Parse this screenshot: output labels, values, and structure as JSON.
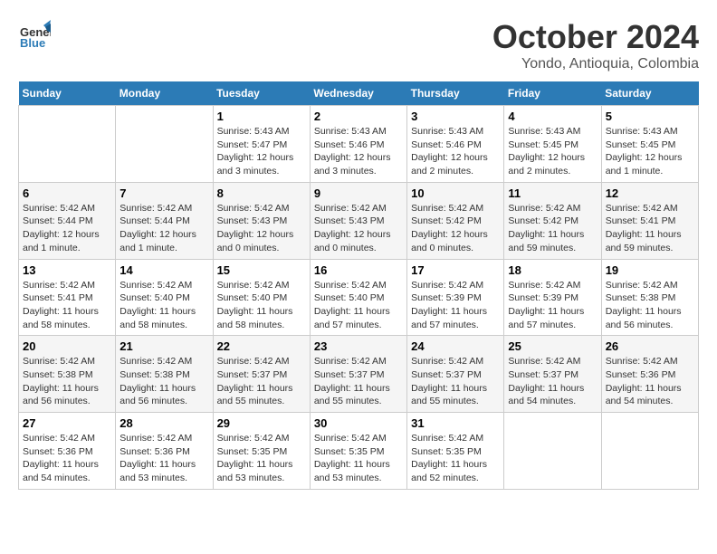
{
  "header": {
    "logo_line1": "General",
    "logo_line2": "Blue",
    "month_title": "October 2024",
    "subtitle": "Yondo, Antioquia, Colombia"
  },
  "weekdays": [
    "Sunday",
    "Monday",
    "Tuesday",
    "Wednesday",
    "Thursday",
    "Friday",
    "Saturday"
  ],
  "weeks": [
    [
      {
        "day": "",
        "empty": true
      },
      {
        "day": "",
        "empty": true
      },
      {
        "day": "1",
        "sunrise": "5:43 AM",
        "sunset": "5:47 PM",
        "daylight": "12 hours and 3 minutes."
      },
      {
        "day": "2",
        "sunrise": "5:43 AM",
        "sunset": "5:46 PM",
        "daylight": "12 hours and 3 minutes."
      },
      {
        "day": "3",
        "sunrise": "5:43 AM",
        "sunset": "5:46 PM",
        "daylight": "12 hours and 2 minutes."
      },
      {
        "day": "4",
        "sunrise": "5:43 AM",
        "sunset": "5:45 PM",
        "daylight": "12 hours and 2 minutes."
      },
      {
        "day": "5",
        "sunrise": "5:43 AM",
        "sunset": "5:45 PM",
        "daylight": "12 hours and 1 minute."
      }
    ],
    [
      {
        "day": "6",
        "sunrise": "5:42 AM",
        "sunset": "5:44 PM",
        "daylight": "12 hours and 1 minute."
      },
      {
        "day": "7",
        "sunrise": "5:42 AM",
        "sunset": "5:44 PM",
        "daylight": "12 hours and 1 minute."
      },
      {
        "day": "8",
        "sunrise": "5:42 AM",
        "sunset": "5:43 PM",
        "daylight": "12 hours and 0 minutes."
      },
      {
        "day": "9",
        "sunrise": "5:42 AM",
        "sunset": "5:43 PM",
        "daylight": "12 hours and 0 minutes."
      },
      {
        "day": "10",
        "sunrise": "5:42 AM",
        "sunset": "5:42 PM",
        "daylight": "12 hours and 0 minutes."
      },
      {
        "day": "11",
        "sunrise": "5:42 AM",
        "sunset": "5:42 PM",
        "daylight": "11 hours and 59 minutes."
      },
      {
        "day": "12",
        "sunrise": "5:42 AM",
        "sunset": "5:41 PM",
        "daylight": "11 hours and 59 minutes."
      }
    ],
    [
      {
        "day": "13",
        "sunrise": "5:42 AM",
        "sunset": "5:41 PM",
        "daylight": "11 hours and 58 minutes."
      },
      {
        "day": "14",
        "sunrise": "5:42 AM",
        "sunset": "5:40 PM",
        "daylight": "11 hours and 58 minutes."
      },
      {
        "day": "15",
        "sunrise": "5:42 AM",
        "sunset": "5:40 PM",
        "daylight": "11 hours and 58 minutes."
      },
      {
        "day": "16",
        "sunrise": "5:42 AM",
        "sunset": "5:40 PM",
        "daylight": "11 hours and 57 minutes."
      },
      {
        "day": "17",
        "sunrise": "5:42 AM",
        "sunset": "5:39 PM",
        "daylight": "11 hours and 57 minutes."
      },
      {
        "day": "18",
        "sunrise": "5:42 AM",
        "sunset": "5:39 PM",
        "daylight": "11 hours and 57 minutes."
      },
      {
        "day": "19",
        "sunrise": "5:42 AM",
        "sunset": "5:38 PM",
        "daylight": "11 hours and 56 minutes."
      }
    ],
    [
      {
        "day": "20",
        "sunrise": "5:42 AM",
        "sunset": "5:38 PM",
        "daylight": "11 hours and 56 minutes."
      },
      {
        "day": "21",
        "sunrise": "5:42 AM",
        "sunset": "5:38 PM",
        "daylight": "11 hours and 56 minutes."
      },
      {
        "day": "22",
        "sunrise": "5:42 AM",
        "sunset": "5:37 PM",
        "daylight": "11 hours and 55 minutes."
      },
      {
        "day": "23",
        "sunrise": "5:42 AM",
        "sunset": "5:37 PM",
        "daylight": "11 hours and 55 minutes."
      },
      {
        "day": "24",
        "sunrise": "5:42 AM",
        "sunset": "5:37 PM",
        "daylight": "11 hours and 55 minutes."
      },
      {
        "day": "25",
        "sunrise": "5:42 AM",
        "sunset": "5:37 PM",
        "daylight": "11 hours and 54 minutes."
      },
      {
        "day": "26",
        "sunrise": "5:42 AM",
        "sunset": "5:36 PM",
        "daylight": "11 hours and 54 minutes."
      }
    ],
    [
      {
        "day": "27",
        "sunrise": "5:42 AM",
        "sunset": "5:36 PM",
        "daylight": "11 hours and 54 minutes."
      },
      {
        "day": "28",
        "sunrise": "5:42 AM",
        "sunset": "5:36 PM",
        "daylight": "11 hours and 53 minutes."
      },
      {
        "day": "29",
        "sunrise": "5:42 AM",
        "sunset": "5:35 PM",
        "daylight": "11 hours and 53 minutes."
      },
      {
        "day": "30",
        "sunrise": "5:42 AM",
        "sunset": "5:35 PM",
        "daylight": "11 hours and 53 minutes."
      },
      {
        "day": "31",
        "sunrise": "5:42 AM",
        "sunset": "5:35 PM",
        "daylight": "11 hours and 52 minutes."
      },
      {
        "day": "",
        "empty": true
      },
      {
        "day": "",
        "empty": true
      }
    ]
  ],
  "labels": {
    "sunrise_prefix": "Sunrise:",
    "sunset_prefix": "Sunset:",
    "daylight_prefix": "Daylight:"
  }
}
